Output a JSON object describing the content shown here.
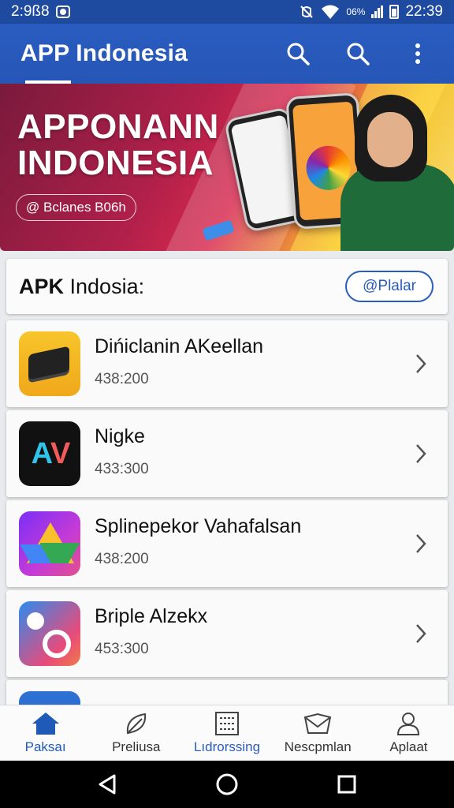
{
  "status_bar": {
    "left_time": "2:9ß8",
    "battery_percent": "06%",
    "time": "22:39"
  },
  "app_bar": {
    "title": "APP Indonesia"
  },
  "banner": {
    "title_line1": "APPONANN",
    "title_line2": "INDONESIA",
    "pill_label": "@ Bclanes B06h"
  },
  "section": {
    "title_bold": "APK",
    "title_rest": " Indosia:",
    "button_label": "@Plalar"
  },
  "apps": [
    {
      "name": "Dińiclanin AKeellan",
      "meta": "438:200",
      "icon": "black-device-icon"
    },
    {
      "name": "Nigke",
      "meta": "433:300",
      "icon": "av-logo-icon"
    },
    {
      "name": "Splinepekor Vahafalsan",
      "meta": "438:200",
      "icon": "triangle-drive-icon"
    },
    {
      "name": "Briple Alzekx",
      "meta": "453:300",
      "icon": "camera-ring-icon"
    },
    {
      "name": "",
      "meta": "",
      "icon": "blue-app-icon"
    }
  ],
  "bottom_nav": [
    {
      "label": "Paksaı",
      "icon": "home-icon"
    },
    {
      "label": "Preliusa",
      "icon": "leaf-icon"
    },
    {
      "label": "Lıdrorssing",
      "icon": "grid-icon"
    },
    {
      "label": "Nescpmlan",
      "icon": "envelope-icon"
    },
    {
      "label": "Aplaat",
      "icon": "person-icon"
    }
  ],
  "colors": {
    "primary": "#2656b6",
    "status_bar": "#1e4aa0",
    "accent_pill": "#2a5cc0"
  }
}
